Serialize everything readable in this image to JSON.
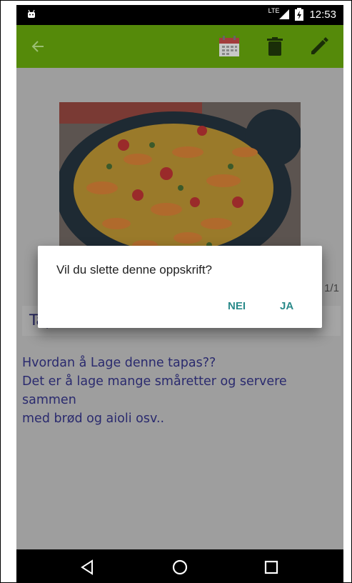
{
  "status_bar": {
    "network": "LTE",
    "time": "12:53"
  },
  "toolbar": {
    "icons": [
      "back-arrow-icon",
      "calendar-icon",
      "trash-icon",
      "edit-pencil-icon"
    ],
    "accent": "#558a0a"
  },
  "recipe": {
    "pager": "1/1",
    "title": "Tapas",
    "description": "Hvordan å Lage denne tapas??\nDet er å lage mange småretter og servere sammen\nmed brød og aioli osv.."
  },
  "dialog": {
    "message": "Vil du slette denne oppskrift?",
    "no_label": "NEI",
    "yes_label": "JA",
    "button_color": "#2a8a8a"
  },
  "nav": {
    "icons": [
      "back-triangle-icon",
      "home-circle-icon",
      "recents-square-icon"
    ]
  }
}
